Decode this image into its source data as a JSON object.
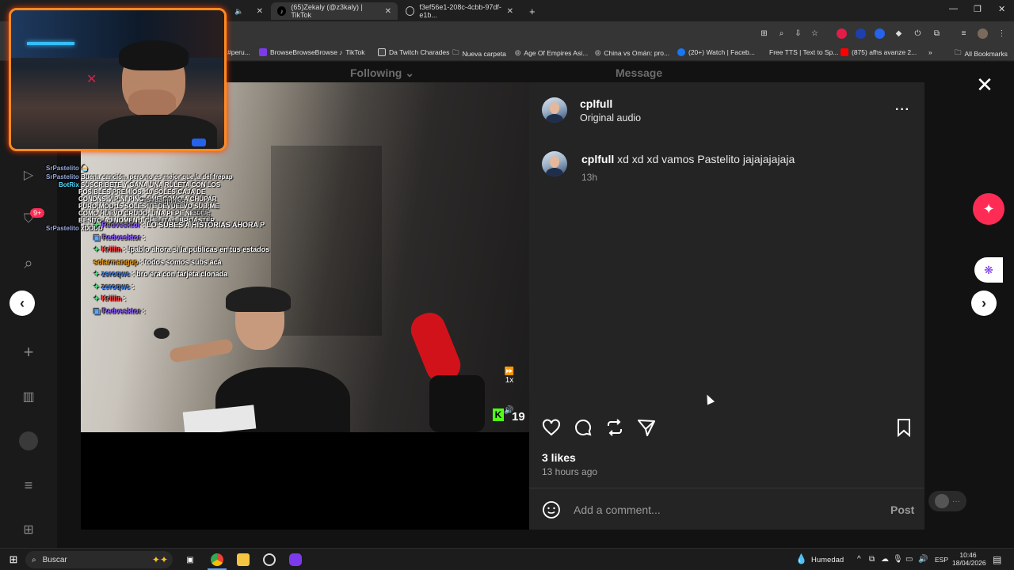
{
  "tabs": [
    {
      "title": ""
    },
    {
      "title": "(65)Zekaly (@z3kaly) | TikTok"
    },
    {
      "title": "f3ef56e1-208c-4cbb-97df-e1b..."
    }
  ],
  "bookmarks": [
    {
      "label": "#peru..."
    },
    {
      "label": "BrowseBrowseBrowse"
    },
    {
      "label": "TikTok"
    },
    {
      "label": "Da Twitch Charades"
    },
    {
      "label": "Nueva carpeta"
    },
    {
      "label": "Age Of Empires Asi..."
    },
    {
      "label": "China vs Omán: pro..."
    },
    {
      "label": "(20+) Watch | Faceb..."
    },
    {
      "label": "Free TTS | Text to Sp..."
    },
    {
      "label": "(875) afhs avanze 2..."
    }
  ],
  "all_bookmarks": "All Bookmarks",
  "tiktok": {
    "following": "Following",
    "message": "Message",
    "nav_badge": "9+"
  },
  "post": {
    "username": "cplfull",
    "audio": "Original audio",
    "comment_user": "cplfull",
    "comment_text": "xd xd xd vamos Pastelito jajajajajaja",
    "comment_time": "13h",
    "likes": "3 likes",
    "posted": "13 hours ago",
    "comment_placeholder": "Add a comment...",
    "post_button": "Post"
  },
  "video": {
    "speed": "1x",
    "counter": "19"
  },
  "stream_chat": [
    {
      "user": "SrPastelito",
      "text": ""
    },
    {
      "user": "SrPastelito",
      "text": "Buena canción, pero no es mejor que la del frepap"
    },
    {
      "user": "BotRix",
      "text": "SUSCRIBETE Y GANA UNA RULETA CON LOS"
    },
    {
      "user": "",
      "text": "POSIBLES PREMIOS: 10 SOLES;CAJA DE"
    },
    {
      "user": "",
      "text": "CONDNS;VIP;NI PING 4:ME COMO A CHUPAR"
    },
    {
      "user": "",
      "text": "PURO;MOD;15 SOLES;TE DEVUELVO SUB;ME"
    },
    {
      "user": "",
      "text": "COMO HUEVO CRUDO; UNA PEPE NEGRA;"
    },
    {
      "user": "",
      "text": "BESITO;AJINOMEN;1 CHELITA;1 BROASTER"
    },
    {
      "user": "SrPastelito",
      "text": "xDDDD"
    }
  ],
  "stream_chat_2": [
    {
      "user": "Redvesktor",
      "text": ": LO SUBES A HISTORIAS AHORA P",
      "color": "#8b5cf6"
    },
    {
      "user": "Redvesktor",
      "text": ":",
      "color": "#8b5cf6"
    },
    {
      "user": "Kriiiin",
      "text": ": !pablo ahora si la publicas en tus estados",
      "color": "#ef4444"
    },
    {
      "user": "solarmangop",
      "text": ": todos somos subs acá",
      "color": "#f59e0b"
    },
    {
      "user": "zeroqwc",
      "text": ": bro era con tarjeta clonada",
      "color": "#3b82f6"
    },
    {
      "user": "zeroqwc",
      "text": ":",
      "color": "#3b82f6"
    },
    {
      "user": "Kriiiin",
      "text": ":",
      "color": "#ef4444"
    },
    {
      "user": "Redvesktor",
      "text": ":",
      "color": "#8b5cf6"
    }
  ],
  "stream_chat_overlap": [
    {
      "text": "te reembolsa"
    },
    {
      "text": "some"
    }
  ],
  "taskbar": {
    "search": "Buscar",
    "weather": "Humedad",
    "lang": "ESP",
    "time": "10:46",
    "date": "18/04/2026"
  },
  "colors": {
    "accent_pink": "#fe2c55",
    "webcam_border": "#ff8a1f",
    "panel_bg": "#242424"
  }
}
